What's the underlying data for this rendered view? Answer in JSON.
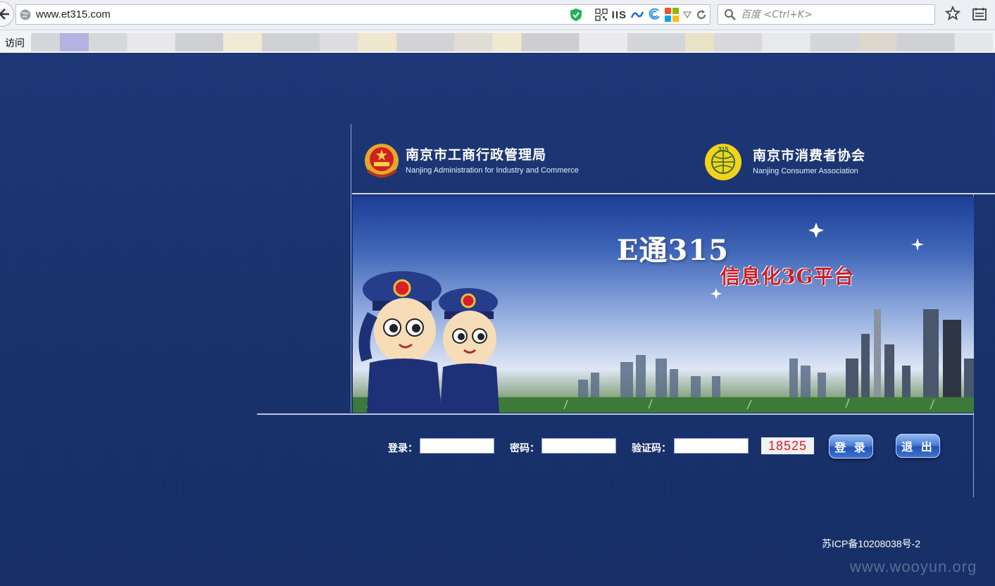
{
  "browser": {
    "url": "www.et315.com",
    "iis_label": "IIS",
    "search_placeholder": "百度 <Ctrl+K>",
    "bookmarks_visit_label": "访问"
  },
  "header": {
    "left_org": {
      "name": "南京市工商行政管理局",
      "english": "Nanjing Administration for Industry and Commerce"
    },
    "right_org": {
      "name": "南京市消费者协会",
      "english": "Nanjing Consumer Association"
    }
  },
  "banner": {
    "title": "E通315",
    "subtitle": "信息化3G平台"
  },
  "login": {
    "username_label": "登录：",
    "password_label": "密码：",
    "captcha_label": "验证码：",
    "captcha_value": "18525",
    "login_button": "登 录",
    "exit_button": "退 出"
  },
  "footer": {
    "icp": "苏ICP备10208038号-2",
    "watermark": "www.wooyun.org"
  },
  "colors": {
    "page_bg": "#17306a",
    "captcha_text": "#e01b22",
    "banner_subtitle": "#c8202a"
  }
}
